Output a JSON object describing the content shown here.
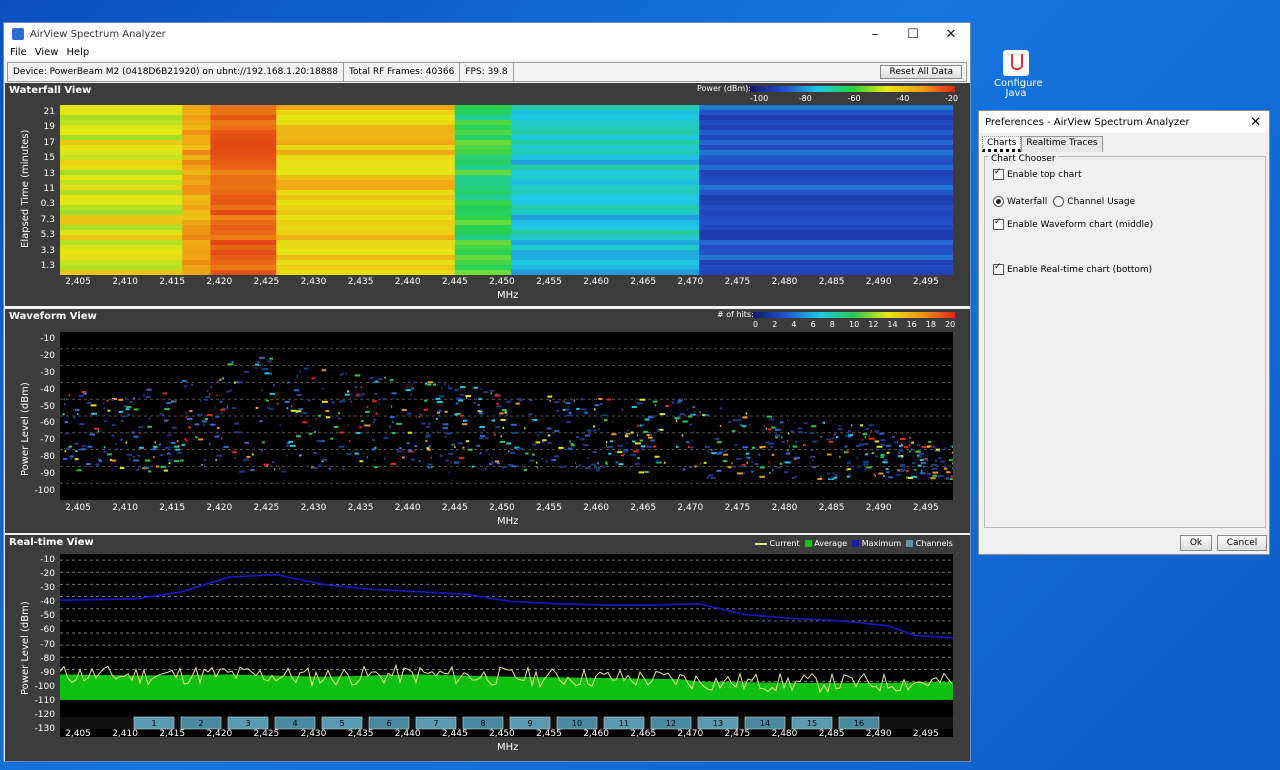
{
  "desktop": {
    "icon_label_1": "Configure",
    "icon_label_2": "Java"
  },
  "window": {
    "title": "AirView Spectrum Analyzer",
    "menu": [
      "File",
      "View",
      "Help"
    ],
    "status": {
      "device": "Device: PowerBeam M2 (0418D6B21920) on ubnt://192.168.1.20:18888",
      "frames": "Total RF Frames: 40366",
      "fps": "FPS: 39.8",
      "reset_label": "Reset All Data"
    }
  },
  "waterfall": {
    "title": "Waterfall View",
    "legend_label": "Power (dBm):",
    "legend_ticks": [
      "-100",
      "-80",
      "-60",
      "-40",
      "-20"
    ],
    "ylabel": "Elapsed Time (minutes)",
    "yticks": [
      "21",
      "19",
      "17",
      "15",
      "13",
      "11",
      "0.3",
      "7.3",
      "5.3",
      "3.3",
      "1.3"
    ],
    "xlabel": "MHz",
    "xticks": [
      "2,405",
      "2,410",
      "2,415",
      "2,420",
      "2,425",
      "2,430",
      "2,435",
      "2,440",
      "2,445",
      "2,450",
      "2,455",
      "2,460",
      "2,465",
      "2,470",
      "2,475",
      "2,480",
      "2,485",
      "2,490",
      "2,495"
    ]
  },
  "waveform": {
    "title": "Waveform View",
    "legend_label": "# of hits:",
    "legend_ticks": [
      "0",
      "2",
      "4",
      "6",
      "8",
      "10",
      "12",
      "14",
      "16",
      "18",
      "20"
    ],
    "ylabel": "Power Level (dBm)",
    "yticks": [
      "-10",
      "-20",
      "-30",
      "-40",
      "-50",
      "-60",
      "-70",
      "-80",
      "-90",
      "-100"
    ],
    "xlabel": "MHz",
    "xticks": [
      "2,405",
      "2,410",
      "2,415",
      "2,420",
      "2,425",
      "2,430",
      "2,435",
      "2,440",
      "2,445",
      "2,450",
      "2,455",
      "2,460",
      "2,465",
      "2,470",
      "2,475",
      "2,480",
      "2,485",
      "2,490",
      "2,495"
    ]
  },
  "realtime": {
    "title": "Real-time View",
    "legend": [
      "Current",
      "Average",
      "Maximum",
      "Channels"
    ],
    "ylabel": "Power Level (dBm)",
    "yticks": [
      "-10",
      "-20",
      "-30",
      "-40",
      "-50",
      "-60",
      "-70",
      "-80",
      "-90",
      "-100",
      "-110",
      "-120",
      "-130"
    ],
    "xlabel": "MHz",
    "xticks": [
      "2,405",
      "2,410",
      "2,415",
      "2,420",
      "2,425",
      "2,430",
      "2,435",
      "2,440",
      "2,445",
      "2,450",
      "2,455",
      "2,460",
      "2,465",
      "2,470",
      "2,475",
      "2,480",
      "2,485",
      "2,490",
      "2,495"
    ],
    "channels": [
      "1",
      "2",
      "3",
      "4",
      "5",
      "6",
      "7",
      "8",
      "9",
      "10",
      "11",
      "12",
      "13",
      "14",
      "15",
      "16"
    ]
  },
  "dialog": {
    "title": "Preferences - AirView Spectrum Analyzer",
    "tabs": [
      "Charts",
      "Realtime Traces"
    ],
    "group": "Chart Chooser",
    "opt_top": "Enable top chart",
    "opt_waterfall": "Waterfall",
    "opt_channel": "Channel Usage",
    "opt_waveform": "Enable Waveform chart (middle)",
    "opt_realtime": "Enable Real-time chart (bottom)",
    "ok": "Ok",
    "cancel": "Cancel"
  },
  "chart_data": [
    {
      "type": "heatmap",
      "title": "Waterfall View",
      "xlabel": "MHz",
      "ylabel": "Elapsed Time (minutes)",
      "x_range": [
        2402,
        2497
      ],
      "colorbar": {
        "label": "Power (dBm):",
        "range": [
          -100,
          -20
        ]
      },
      "bands": [
        {
          "from": 2402,
          "to": 2415,
          "dbm": -50
        },
        {
          "from": 2415,
          "to": 2418,
          "dbm": -40
        },
        {
          "from": 2418,
          "to": 2425,
          "dbm": -30
        },
        {
          "from": 2425,
          "to": 2444,
          "dbm": -45
        },
        {
          "from": 2444,
          "to": 2450,
          "dbm": -62
        },
        {
          "from": 2450,
          "to": 2470,
          "dbm": -72
        },
        {
          "from": 2470,
          "to": 2497,
          "dbm": -85
        }
      ]
    },
    {
      "type": "line",
      "title": "Real-time View",
      "xlabel": "MHz",
      "ylabel": "Power Level (dBm)",
      "x_range": [
        2402,
        2497
      ],
      "ylim": [
        -130,
        -10
      ],
      "series": [
        {
          "name": "Maximum",
          "x": [
            2402,
            2410,
            2415,
            2420,
            2425,
            2430,
            2435,
            2440,
            2445,
            2450,
            2455,
            2460,
            2465,
            2470,
            2475,
            2480,
            2485,
            2490,
            2493,
            2497
          ],
          "values": [
            -43,
            -42,
            -36,
            -24,
            -22,
            -30,
            -34,
            -36,
            -38,
            -44,
            -46,
            -47,
            -47,
            -46,
            -55,
            -58,
            -60,
            -64,
            -72,
            -74
          ]
        },
        {
          "name": "Average",
          "x": [
            2402,
            2410,
            2420,
            2430,
            2440,
            2450,
            2460,
            2468,
            2470,
            2480,
            2490,
            2497
          ],
          "values": [
            -104,
            -105,
            -104,
            -106,
            -104,
            -106,
            -107,
            -108,
            -110,
            -111,
            -111,
            -110
          ]
        }
      ]
    }
  ]
}
